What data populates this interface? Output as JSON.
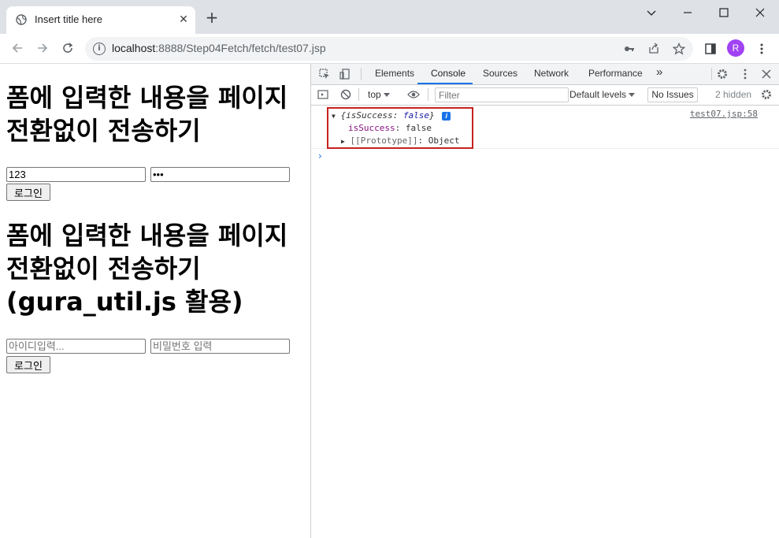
{
  "browser": {
    "tab_title": "Insert title here",
    "tab_close": "✕",
    "new_tab": "+",
    "window_controls": {
      "minimize": "—",
      "maximize": "☐",
      "close": "✕"
    },
    "url_host": "localhost",
    "url_rest": ":8888/Step04Fetch/fetch/test07.jsp",
    "profile_initial": "R",
    "icons": [
      "back-icon",
      "forward-icon",
      "reload-icon",
      "info-icon",
      "key-icon",
      "share-icon",
      "star-icon",
      "side-panel-icon",
      "menu-icon"
    ]
  },
  "page": {
    "heading1": "폼에 입력한 내용을 페이지 전환없이 전송하기",
    "form1": {
      "id_value": "123",
      "pwd_value": "•••",
      "submit_label": "로그인"
    },
    "heading2": "폼에 입력한 내용을 페이지 전환없이 전송하기(gura_util.js 활용)",
    "form2": {
      "id_placeholder": "아이디입력...",
      "pwd_placeholder": "비밀번호 입력",
      "submit_label": "로그인"
    }
  },
  "devtools": {
    "tabs": [
      "Elements",
      "Console",
      "Sources",
      "Network",
      "Performance"
    ],
    "active_tab": "Console",
    "more_tabs": "»",
    "context": "top",
    "filter_placeholder": "Filter",
    "levels": "Default levels",
    "issues": "No Issues",
    "hidden": "2 hidden",
    "console_entry": {
      "summary_open": "{",
      "summary_key": "isSuccess",
      "summary_value": "false",
      "summary_close": "}",
      "info_badge": "i",
      "prop_key": "isSuccess",
      "prop_value": "false",
      "proto_label": "[[Prototype]]",
      "proto_value": "Object",
      "source": "test07.jsp:58"
    },
    "prompt": "›",
    "accent_color": "#1a73e8",
    "highlight_color": "#c5221f"
  }
}
